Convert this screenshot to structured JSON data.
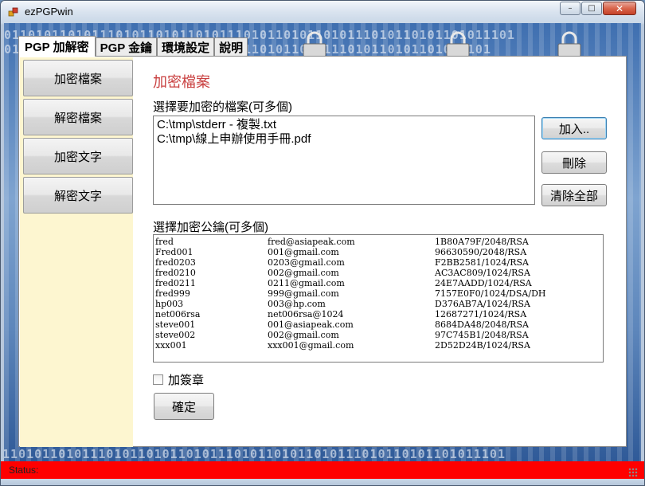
{
  "window": {
    "title": "ezPGPwin",
    "minimize_glyph": "–",
    "maximize_glyph": "□",
    "close_glyph": "✕"
  },
  "background": {
    "binary_text": "0110101101011101011010110101110101101011010111010110101101011101"
  },
  "tabs": [
    {
      "label": "PGP 加解密",
      "active": true
    },
    {
      "label": "PGP 金鑰",
      "active": false
    },
    {
      "label": "環境設定",
      "active": false
    },
    {
      "label": "說明",
      "active": false
    }
  ],
  "sidebar": {
    "items": [
      {
        "label": "加密檔案"
      },
      {
        "label": "解密檔案"
      },
      {
        "label": "加密文字"
      },
      {
        "label": "解密文字"
      }
    ]
  },
  "main": {
    "heading": "加密檔案",
    "files_label": "選擇要加密的檔案(可多個)",
    "files": [
      "C:\\tmp\\stderr - 複製.txt",
      "C:\\tmp\\線上申辦使用手冊.pdf"
    ],
    "add_button": "加入..",
    "delete_button": "刪除",
    "clear_button": "清除全部",
    "keys_label": "選擇加密公鑰(可多個)",
    "keys": [
      {
        "name": "fred",
        "email": "fred@asiapeak.com",
        "id": "1B80A79F/2048/RSA"
      },
      {
        "name": "Fred001",
        "email": "001@gmail.com",
        "id": "96630590/2048/RSA"
      },
      {
        "name": "fred0203",
        "email": "0203@gmail.com",
        "id": "F2BB2581/1024/RSA"
      },
      {
        "name": "fred0210",
        "email": "002@gmail.com",
        "id": "AC3AC809/1024/RSA"
      },
      {
        "name": "fred0211",
        "email": "0211@gmail.com",
        "id": "24E7AADD/1024/RSA"
      },
      {
        "name": "fred999",
        "email": "999@gmail.com",
        "id": "7157E0F0/1024/DSA/DH"
      },
      {
        "name": "hp003",
        "email": "003@hp.com",
        "id": "D376AB7A/1024/RSA"
      },
      {
        "name": "net006rsa",
        "email": "net006rsa@1024",
        "id": "12687271/1024/RSA"
      },
      {
        "name": "steve001",
        "email": "001@asiapeak.com",
        "id": "8684DA48/2048/RSA"
      },
      {
        "name": "steve002",
        "email": "002@gmail.com",
        "id": "97C745B1/2048/RSA"
      },
      {
        "name": "xxx001",
        "email": "xxx001@gmail.com",
        "id": "2D52D24B/1024/RSA"
      }
    ],
    "sign_label": "加簽章",
    "sign_checked": false,
    "ok_button": "確定"
  },
  "statusbar": {
    "text": "Status:"
  }
}
